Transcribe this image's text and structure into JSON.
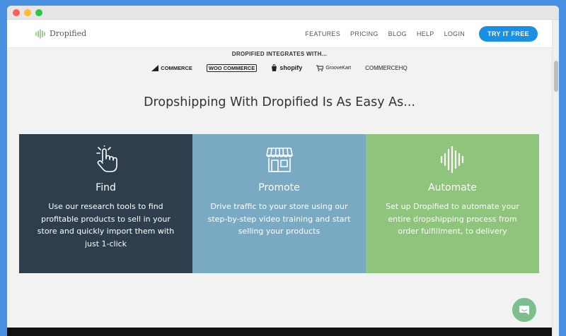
{
  "window": {
    "controls": {
      "close_color": "#ff5f57",
      "minimize_color": "#febc2e",
      "maximize_color": "#28c840"
    }
  },
  "navbar": {
    "logo_text": "Dropified",
    "links": [
      "FEATURES",
      "PRICING",
      "BLOG",
      "HELP",
      "LOGIN"
    ],
    "cta_label": "TRY IT FREE",
    "cta_color": "#1a8fe3"
  },
  "integrations": {
    "title": "DROPIFIED INTEGRATES WITH...",
    "partners": [
      "COMMERCE",
      "WOO COMMERCE",
      "shopify",
      "GrooveKart",
      "COMMERCEHQ"
    ]
  },
  "headline": "Dropshipping With Dropified Is As Easy As...",
  "cards": [
    {
      "icon": "hand-pointer-icon",
      "title": "Find",
      "text": "Use our research tools to find profitable products to sell in your store and quickly import them with just 1-click",
      "color": "#2e3e4c"
    },
    {
      "icon": "storefront-icon",
      "title": "Promote",
      "text": "Drive traffic to your store using our step-by-step video training and start selling your products",
      "color": "#7aa9c4"
    },
    {
      "icon": "waveform-icon",
      "title": "Automate",
      "text": "Set up Dropified to automate your entire dropshipping process from order fulfillment, to delivery",
      "color": "#8ec47b"
    }
  ],
  "chat": {
    "icon": "chat-bubble-icon",
    "color": "#7dbf8c"
  }
}
